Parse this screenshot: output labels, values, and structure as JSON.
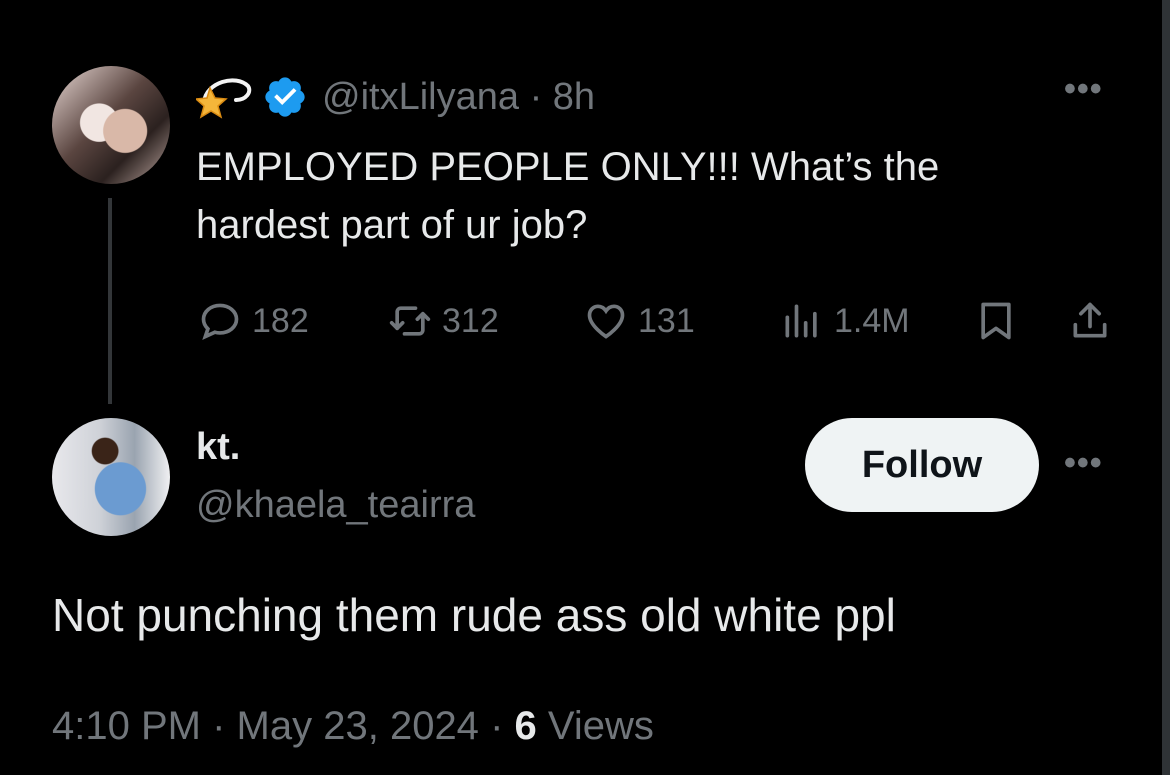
{
  "parent_tweet": {
    "handle": "@itxLilyana",
    "separator": "·",
    "time": "8h",
    "text": "EMPLOYED PEOPLE ONLY!!! What’s the hardest part of ur job?",
    "badge_icon": "dizzy-star-emoji",
    "verified_color": "#1d9bf0",
    "stats": {
      "replies": "182",
      "reposts": "312",
      "likes": "131",
      "views": "1.4M"
    }
  },
  "reply": {
    "name": "kt.",
    "handle": "@khaela_teairra",
    "follow_label": "Follow",
    "text": "Not punching them rude ass old white ppl",
    "time": "4:10 PM",
    "date": "May 23, 2024",
    "separator": "·",
    "views_count": "6",
    "views_label": "Views"
  },
  "more_label": "•••",
  "colors": {
    "background": "#000000",
    "text": "#e7e9ea",
    "muted": "#71767b",
    "button": "#eff3f4"
  }
}
